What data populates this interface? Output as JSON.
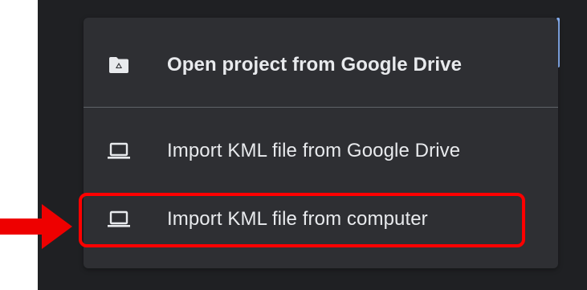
{
  "menu": {
    "items": [
      {
        "label": "Open project from Google Drive",
        "icon": "google-drive-folder-icon"
      },
      {
        "label": "Import KML file from Google Drive",
        "icon": "laptop-icon"
      },
      {
        "label": "Import KML file from computer",
        "icon": "laptop-icon"
      }
    ]
  },
  "annotation": {
    "highlight_color": "#ff0000",
    "arrow_icon": "red-arrow-right-icon"
  },
  "colors": {
    "menu_background": "#2e2f33",
    "page_background": "#1f2023",
    "text": "#e8eaed",
    "scroll_accent": "#8ab4f8"
  }
}
